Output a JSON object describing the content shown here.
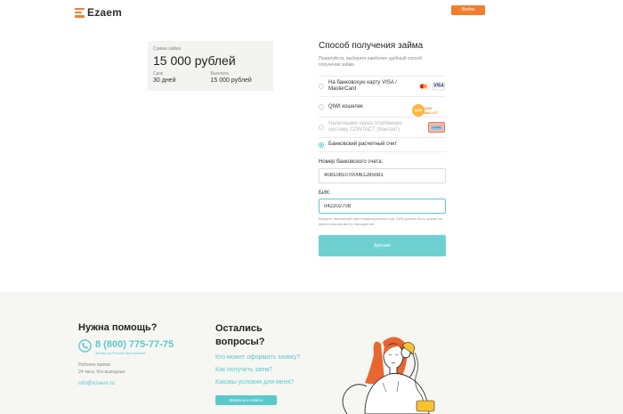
{
  "header": {
    "logo_text": "Ezaem",
    "login_label": "Войти"
  },
  "summary": {
    "amount_label": "Сумма займа",
    "amount_value": "15 000 рублей",
    "term_label": "Срок",
    "term_value": "30 дней",
    "payout_label": "Выплата",
    "payout_value": "15 000 рублей"
  },
  "form": {
    "title": "Способ получения займа",
    "hint": "Пожалуйста, выберите наиболее удобный способ получения займа",
    "methods": [
      {
        "label": "На банковскую карту VISA / MasterCard",
        "icon": "card-icon",
        "state": "enabled"
      },
      {
        "label": "QIWI кошелек",
        "icon": "qiwi-icon",
        "state": "enabled",
        "icon_text": "QIWI WALLET",
        "icon_circle": "QIWI"
      },
      {
        "label": "Наличными через платёжную систему CONTACT (Контакт)",
        "icon": "contact-icon",
        "state": "disabled",
        "icon_text": "contact"
      },
      {
        "label": "Банковский расчетный счет",
        "state": "selected"
      }
    ],
    "account_label": "Номер банковского счета:",
    "account_value": "40810810700061285081",
    "bik_label": "БИК:",
    "bik_value": "042202708",
    "bik_note": "Введите банковский идентификационный код. БИК должен быть указан по фактическому месту нахождения",
    "submit_label": "Дальше",
    "card_brand": "VISA"
  },
  "footer": {
    "help_title": "Нужна помощь?",
    "phone": "8 (800) 775-77-75",
    "phone_note": "Звонок по России бесплатный",
    "work_label": "Рабочее время:",
    "work_value": "24 часа, без выходных",
    "email": "info@ezaem.ru",
    "questions_title_1": "Остались",
    "questions_title_2": "вопросы?",
    "links": [
      "Кто может оформить заявку?",
      "Как получить заем?",
      "Каковы условия для меня?"
    ],
    "questions_button": "Вопросы и ответы"
  },
  "colors": {
    "accent": "#5bc9cc",
    "brand_orange": "#f27d2d"
  }
}
